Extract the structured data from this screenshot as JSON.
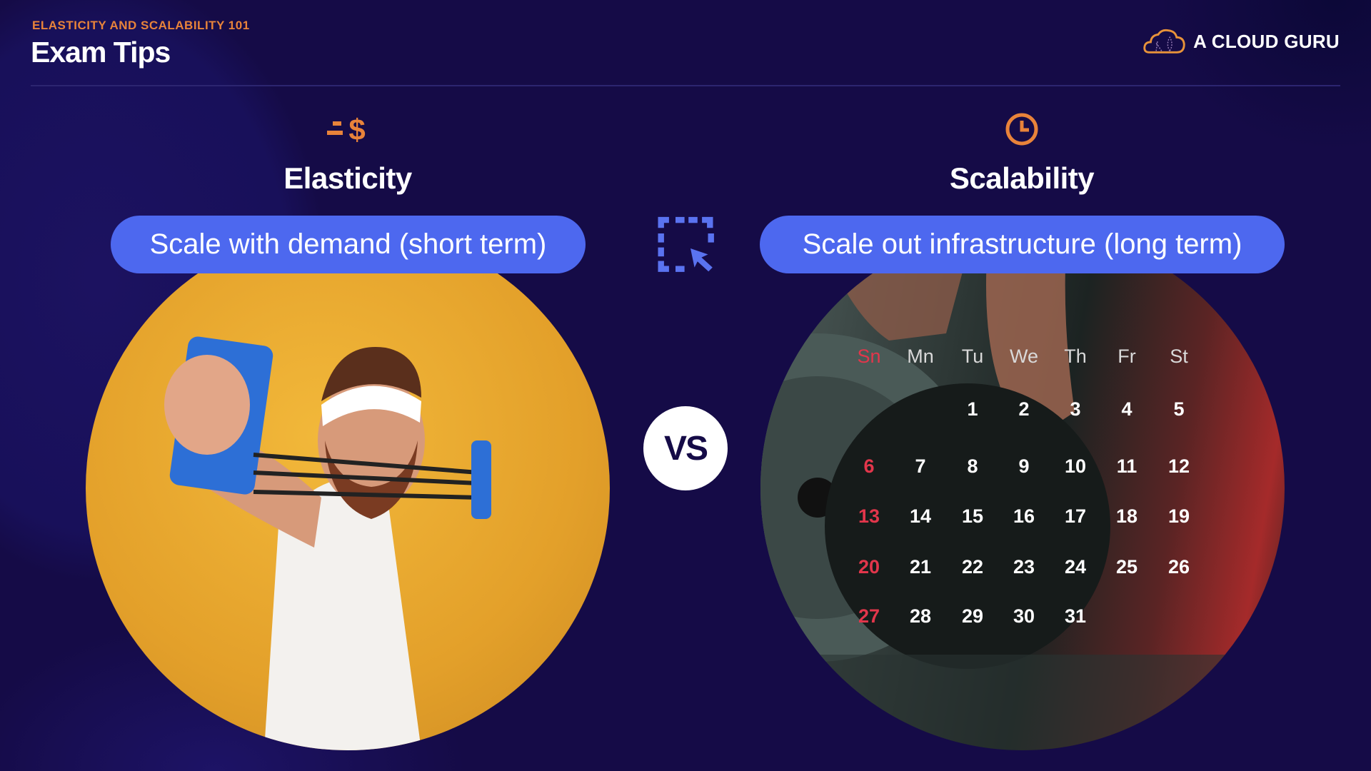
{
  "header": {
    "subtitle": "ELASTICITY AND SCALABILITY 101",
    "title": "Exam Tips"
  },
  "logo": {
    "text": "A CLOUD GURU",
    "icon": "cloud-icon",
    "color": "#e8933a"
  },
  "left": {
    "icon": "fast-dollar-icon",
    "heading": "Elasticity",
    "pill": "Scale with demand (short term)",
    "image": "man-with-chest-expander-photo"
  },
  "right": {
    "icon": "clock-icon",
    "heading": "Scalability",
    "pill": "Scale out infrastructure (long term)",
    "image": "weightlifting-barbell-photo"
  },
  "center": {
    "icon": "dashed-select-cursor-icon",
    "vs": "VS"
  },
  "calendar": {
    "days_header": [
      "Sn",
      "Mn",
      "Tu",
      "We",
      "Th",
      "Fr",
      "St"
    ],
    "weeks": [
      [
        "",
        "",
        "1",
        "2",
        "3",
        "4",
        "5"
      ],
      [
        "6",
        "7",
        "8",
        "9",
        "10",
        "11",
        "12"
      ],
      [
        "13",
        "14",
        "15",
        "16",
        "17",
        "18",
        "19"
      ],
      [
        "20",
        "21",
        "22",
        "23",
        "24",
        "25",
        "26"
      ],
      [
        "27",
        "28",
        "29",
        "30",
        "31",
        "",
        ""
      ]
    ]
  },
  "colors": {
    "background": "#150b47",
    "accent_orange": "#e8833a",
    "pill_blue": "#4d68ef",
    "sunday_red": "#e2364b"
  }
}
